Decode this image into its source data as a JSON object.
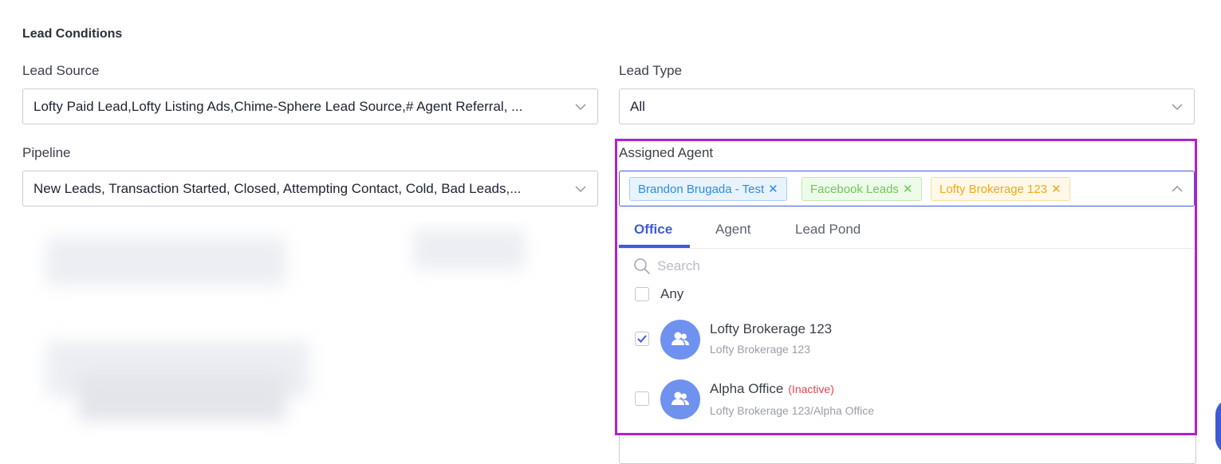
{
  "section": {
    "title": "Lead Conditions"
  },
  "lead_source": {
    "label": "Lead Source",
    "value": "Lofty Paid Lead,Lofty Listing Ads,Chime-Sphere Lead Source,# Agent Referral, ..."
  },
  "lead_type": {
    "label": "Lead Type",
    "value": "All"
  },
  "pipeline": {
    "label": "Pipeline",
    "value": "New Leads, Transaction Started, Closed, Attempting Contact, Cold, Bad Leads,..."
  },
  "assigned_agent": {
    "label": "Assigned Agent",
    "tags": [
      {
        "label": "Brandon Brugada - Test",
        "color": "#2e8ce6"
      },
      {
        "label": "Facebook Leads",
        "color": "#6dc853"
      },
      {
        "label": "Lofty Brokerage 123",
        "color": "#f0a91a"
      }
    ],
    "tag_remove_glyph": "✕",
    "tabs": [
      {
        "label": "Office",
        "active": true
      },
      {
        "label": "Agent",
        "active": false
      },
      {
        "label": "Lead Pond",
        "active": false
      }
    ],
    "search": {
      "placeholder": "Search",
      "value": ""
    },
    "any_option": {
      "label": "Any",
      "checked": false
    },
    "options": [
      {
        "title": "Lofty Brokerage 123",
        "status": "",
        "subtitle": "Lofty Brokerage 123",
        "checked": true
      },
      {
        "title": "Alpha Office",
        "status": "(Inactive)",
        "subtitle": "Lofty Brokerage 123/Alpha Office",
        "checked": false
      }
    ]
  },
  "colors": {
    "accent": "#3d5bd9",
    "highlight_border": "#b31fcf",
    "inactive": "#e5464f",
    "avatar": "#6f91f0"
  }
}
